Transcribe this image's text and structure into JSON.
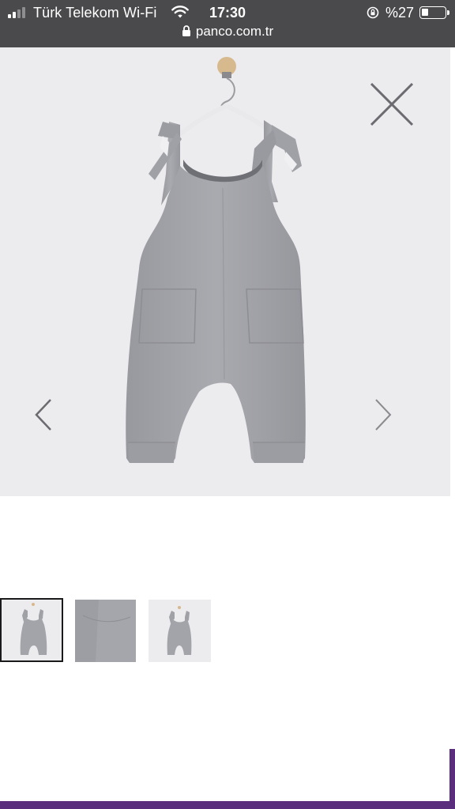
{
  "status_bar": {
    "carrier": "Türk Telekom Wi-Fi",
    "time": "17:30",
    "battery_percent": "%27",
    "battery_level": 0.27,
    "signal_bars_active": 2,
    "signal_bars_total": 4
  },
  "browser": {
    "url": "panco.com.tr"
  },
  "gallery": {
    "selected_index": 0,
    "thumbnails": [
      {
        "view": "full-front"
      },
      {
        "view": "fabric-closeup"
      },
      {
        "view": "full-front-small"
      }
    ],
    "product_color": "#a3a4a9"
  },
  "colors": {
    "statusbar_bg": "#4a4a4c",
    "gallery_bg": "#ececee",
    "accent_purple": "#5a2e7c"
  }
}
